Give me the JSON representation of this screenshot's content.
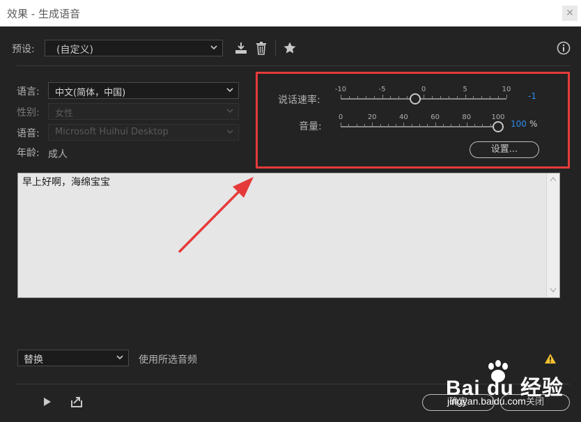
{
  "window": {
    "title": "效果 - 生成语音",
    "close_label": "✕"
  },
  "preset": {
    "label": "预设:",
    "value": "(自定义)"
  },
  "voice": {
    "language_label": "语言:",
    "language_value": "中文(简体，中国)",
    "gender_label": "性别:",
    "gender_value": "女性",
    "voice_label": "语音:",
    "voice_value": "Microsoft Huihui Desktop",
    "age_label": "年龄:",
    "age_value": "成人"
  },
  "speech": {
    "rate_label": "说话速率:",
    "rate_ticks": [
      "-10",
      "-5",
      "0",
      "5",
      "10"
    ],
    "rate_min": -10,
    "rate_max": 10,
    "rate_value": -1,
    "rate_value_text": "-1",
    "volume_label": "音量:",
    "volume_ticks": [
      "0",
      "20",
      "40",
      "60",
      "80",
      "100"
    ],
    "volume_min": 0,
    "volume_max": 100,
    "volume_value": 100,
    "volume_value_text": "100",
    "volume_unit": "%",
    "settings_label": "设置..."
  },
  "text_input": {
    "value": "早上好啊，海绵宝宝"
  },
  "bottom": {
    "mode_value": "替换",
    "use_selected_audio_label": "使用所选音频",
    "ok_label": "确定",
    "close_label": "关闭"
  },
  "watermark": {
    "brand": "Bai du 经验",
    "url": "jingyan.baidu.com"
  },
  "colors": {
    "background": "#232323",
    "highlight_border": "#e63a3a",
    "accent_blue": "#2d8ceb",
    "annotation_arrow": "#e63a3a",
    "warning": "#f2c12e"
  }
}
